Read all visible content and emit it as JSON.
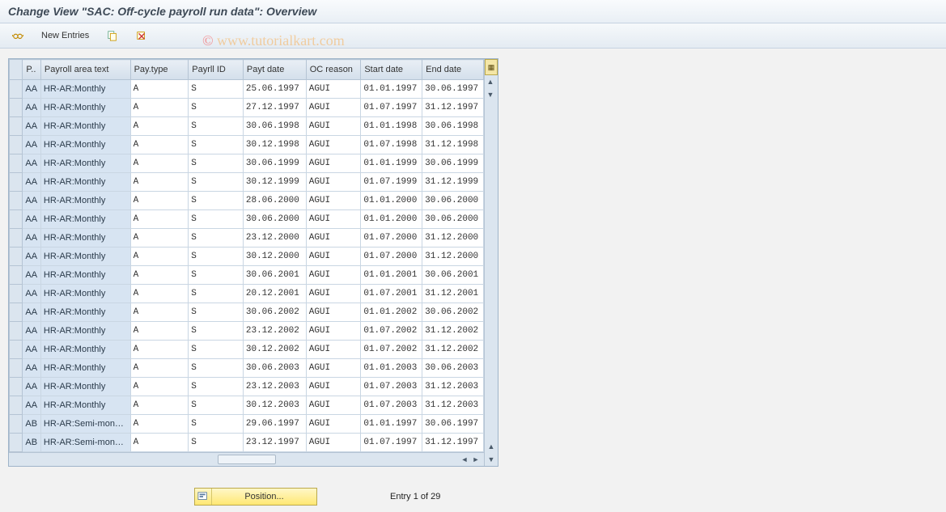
{
  "title": "Change View \"SAC: Off-cycle payroll run data\": Overview",
  "toolbar": {
    "new_entries_label": "New Entries"
  },
  "watermark": "www.tutorialkart.com",
  "columns": {
    "sel": "",
    "p": "P..",
    "area_text": "Payroll area text",
    "pay_type": "Pay.type",
    "payrll_id": "Payrll ID",
    "payt_date": "Payt date",
    "oc_reason": "OC reason",
    "start_date": "Start date",
    "end_date": "End date"
  },
  "rows": [
    {
      "p": "AA",
      "area": "HR-AR:Monthly",
      "ptype": "A",
      "pid": "S",
      "pdate": "25.06.1997",
      "ocr": "AGUI",
      "sdate": "01.01.1997",
      "edate": "30.06.1997"
    },
    {
      "p": "AA",
      "area": "HR-AR:Monthly",
      "ptype": "A",
      "pid": "S",
      "pdate": "27.12.1997",
      "ocr": "AGUI",
      "sdate": "01.07.1997",
      "edate": "31.12.1997"
    },
    {
      "p": "AA",
      "area": "HR-AR:Monthly",
      "ptype": "A",
      "pid": "S",
      "pdate": "30.06.1998",
      "ocr": "AGUI",
      "sdate": "01.01.1998",
      "edate": "30.06.1998"
    },
    {
      "p": "AA",
      "area": "HR-AR:Monthly",
      "ptype": "A",
      "pid": "S",
      "pdate": "30.12.1998",
      "ocr": "AGUI",
      "sdate": "01.07.1998",
      "edate": "31.12.1998"
    },
    {
      "p": "AA",
      "area": "HR-AR:Monthly",
      "ptype": "A",
      "pid": "S",
      "pdate": "30.06.1999",
      "ocr": "AGUI",
      "sdate": "01.01.1999",
      "edate": "30.06.1999"
    },
    {
      "p": "AA",
      "area": "HR-AR:Monthly",
      "ptype": "A",
      "pid": "S",
      "pdate": "30.12.1999",
      "ocr": "AGUI",
      "sdate": "01.07.1999",
      "edate": "31.12.1999"
    },
    {
      "p": "AA",
      "area": "HR-AR:Monthly",
      "ptype": "A",
      "pid": "S",
      "pdate": "28.06.2000",
      "ocr": "AGUI",
      "sdate": "01.01.2000",
      "edate": "30.06.2000"
    },
    {
      "p": "AA",
      "area": "HR-AR:Monthly",
      "ptype": "A",
      "pid": "S",
      "pdate": "30.06.2000",
      "ocr": "AGUI",
      "sdate": "01.01.2000",
      "edate": "30.06.2000"
    },
    {
      "p": "AA",
      "area": "HR-AR:Monthly",
      "ptype": "A",
      "pid": "S",
      "pdate": "23.12.2000",
      "ocr": "AGUI",
      "sdate": "01.07.2000",
      "edate": "31.12.2000"
    },
    {
      "p": "AA",
      "area": "HR-AR:Monthly",
      "ptype": "A",
      "pid": "S",
      "pdate": "30.12.2000",
      "ocr": "AGUI",
      "sdate": "01.07.2000",
      "edate": "31.12.2000"
    },
    {
      "p": "AA",
      "area": "HR-AR:Monthly",
      "ptype": "A",
      "pid": "S",
      "pdate": "30.06.2001",
      "ocr": "AGUI",
      "sdate": "01.01.2001",
      "edate": "30.06.2001"
    },
    {
      "p": "AA",
      "area": "HR-AR:Monthly",
      "ptype": "A",
      "pid": "S",
      "pdate": "20.12.2001",
      "ocr": "AGUI",
      "sdate": "01.07.2001",
      "edate": "31.12.2001"
    },
    {
      "p": "AA",
      "area": "HR-AR:Monthly",
      "ptype": "A",
      "pid": "S",
      "pdate": "30.06.2002",
      "ocr": "AGUI",
      "sdate": "01.01.2002",
      "edate": "30.06.2002"
    },
    {
      "p": "AA",
      "area": "HR-AR:Monthly",
      "ptype": "A",
      "pid": "S",
      "pdate": "23.12.2002",
      "ocr": "AGUI",
      "sdate": "01.07.2002",
      "edate": "31.12.2002"
    },
    {
      "p": "AA",
      "area": "HR-AR:Monthly",
      "ptype": "A",
      "pid": "S",
      "pdate": "30.12.2002",
      "ocr": "AGUI",
      "sdate": "01.07.2002",
      "edate": "31.12.2002"
    },
    {
      "p": "AA",
      "area": "HR-AR:Monthly",
      "ptype": "A",
      "pid": "S",
      "pdate": "30.06.2003",
      "ocr": "AGUI",
      "sdate": "01.01.2003",
      "edate": "30.06.2003"
    },
    {
      "p": "AA",
      "area": "HR-AR:Monthly",
      "ptype": "A",
      "pid": "S",
      "pdate": "23.12.2003",
      "ocr": "AGUI",
      "sdate": "01.07.2003",
      "edate": "31.12.2003"
    },
    {
      "p": "AA",
      "area": "HR-AR:Monthly",
      "ptype": "A",
      "pid": "S",
      "pdate": "30.12.2003",
      "ocr": "AGUI",
      "sdate": "01.07.2003",
      "edate": "31.12.2003"
    },
    {
      "p": "AB",
      "area": "HR-AR:Semi-mon…",
      "ptype": "A",
      "pid": "S",
      "pdate": "29.06.1997",
      "ocr": "AGUI",
      "sdate": "01.01.1997",
      "edate": "30.06.1997"
    },
    {
      "p": "AB",
      "area": "HR-AR:Semi-mon…",
      "ptype": "A",
      "pid": "S",
      "pdate": "23.12.1997",
      "ocr": "AGUI",
      "sdate": "01.07.1997",
      "edate": "31.12.1997"
    }
  ],
  "footer": {
    "position_label": "Position...",
    "entry_text": "Entry 1 of 29"
  }
}
